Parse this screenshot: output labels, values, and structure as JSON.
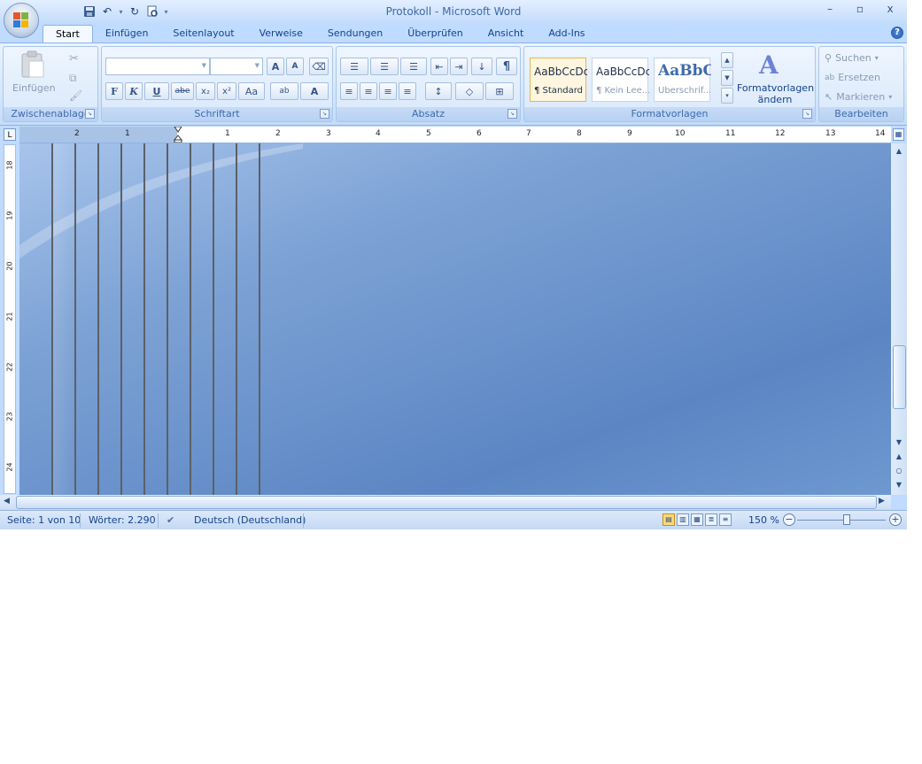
{
  "window": {
    "title": "Protokoll - Microsoft Word",
    "minimize": "–",
    "restore": "▫",
    "close": "x"
  },
  "qat": {
    "save_icon": "save-icon",
    "undo": "↶",
    "redo": "↻",
    "customize": "▾"
  },
  "tabs": [
    "Start",
    "Einfügen",
    "Seitenlayout",
    "Verweise",
    "Sendungen",
    "Überprüfen",
    "Ansicht",
    "Add-Ins"
  ],
  "help": "?",
  "ribbon": {
    "clipboard": {
      "label": "Zwischenablage",
      "paste": "Einfügen"
    },
    "font": {
      "label": "Schriftart",
      "font_name": "",
      "font_size": "",
      "bold": "F",
      "italic": "K",
      "underline": "U",
      "strike": "abe",
      "subscript": "x₂",
      "superscript": "x²",
      "case": "Aa",
      "grow": "A",
      "shrink": "A",
      "highlight": "ab",
      "color": "A"
    },
    "paragraph": {
      "label": "Absatz",
      "show_marks": "¶"
    },
    "styles": {
      "label": "Formatvorlagen",
      "items": [
        {
          "sample": "AaBbCcDc",
          "name": "¶ Standard"
        },
        {
          "sample": "AaBbCcDc",
          "name": "¶ Kein Lee..."
        },
        {
          "sample": "AaBbC(",
          "name": "Überschrif..."
        }
      ],
      "change_line1": "Formatvorlagen",
      "change_line2": "ändern"
    },
    "editing": {
      "label": "Bearbeiten",
      "find": "Suchen",
      "replace": "Ersetzen",
      "select": "Markieren"
    }
  },
  "ruler": {
    "tab_selector": "L",
    "h_labels": [
      "2",
      "1",
      "1",
      "2",
      "3",
      "4",
      "5",
      "6",
      "7",
      "8",
      "9",
      "10",
      "11",
      "12",
      "13",
      "14"
    ],
    "v_labels": [
      "18",
      "19",
      "20",
      "21",
      "22",
      "23",
      "24"
    ]
  },
  "status": {
    "page": "Seite: 1 von 10",
    "words": "Wörter: 2.290",
    "language": "Deutsch (Deutschland)",
    "zoom": "150 %",
    "zoom_out": "−",
    "zoom_in": "+"
  }
}
